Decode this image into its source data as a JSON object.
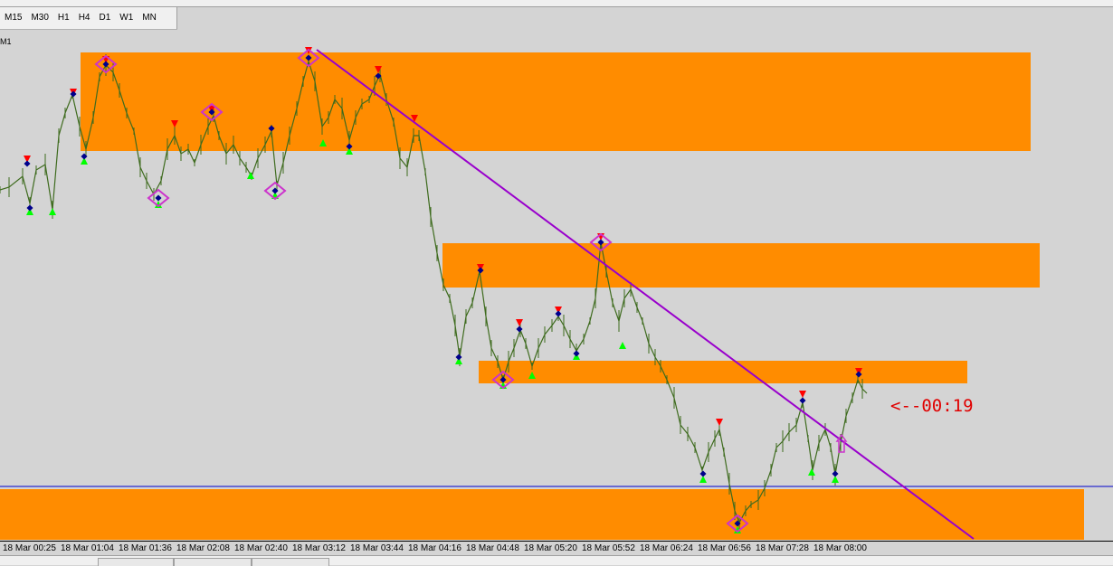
{
  "toolbar": {
    "timeframes": [
      "M15",
      "M30",
      "H1",
      "H4",
      "D1",
      "W1",
      "MN"
    ]
  },
  "chart": {
    "symbol_label": "M1",
    "countdown": "<--00:19",
    "colors": {
      "background": "#d4d4d4",
      "zone": "#ff8c00",
      "candles": "#3e6b1e",
      "trendline": "#9900cc",
      "arrow_down": "#ff0000",
      "arrow_up": "#00ff00",
      "pivot_dot": "#00008b",
      "pivot_marker": "#cc33cc",
      "price_line": "#0000cc"
    },
    "time_labels": [
      "18 Mar 00:25",
      "18 Mar 01:04",
      "18 Mar 01:36",
      "18 Mar 02:08",
      "18 Mar 02:40",
      "18 Mar 03:12",
      "18 Mar 03:44",
      "18 Mar 04:16",
      "18 Mar 04:48",
      "18 Mar 05:20",
      "18 Mar 05:52",
      "18 Mar 06:24",
      "18 Mar 06:56",
      "18 Mar 07:28",
      "18 Mar 08:00"
    ]
  }
}
